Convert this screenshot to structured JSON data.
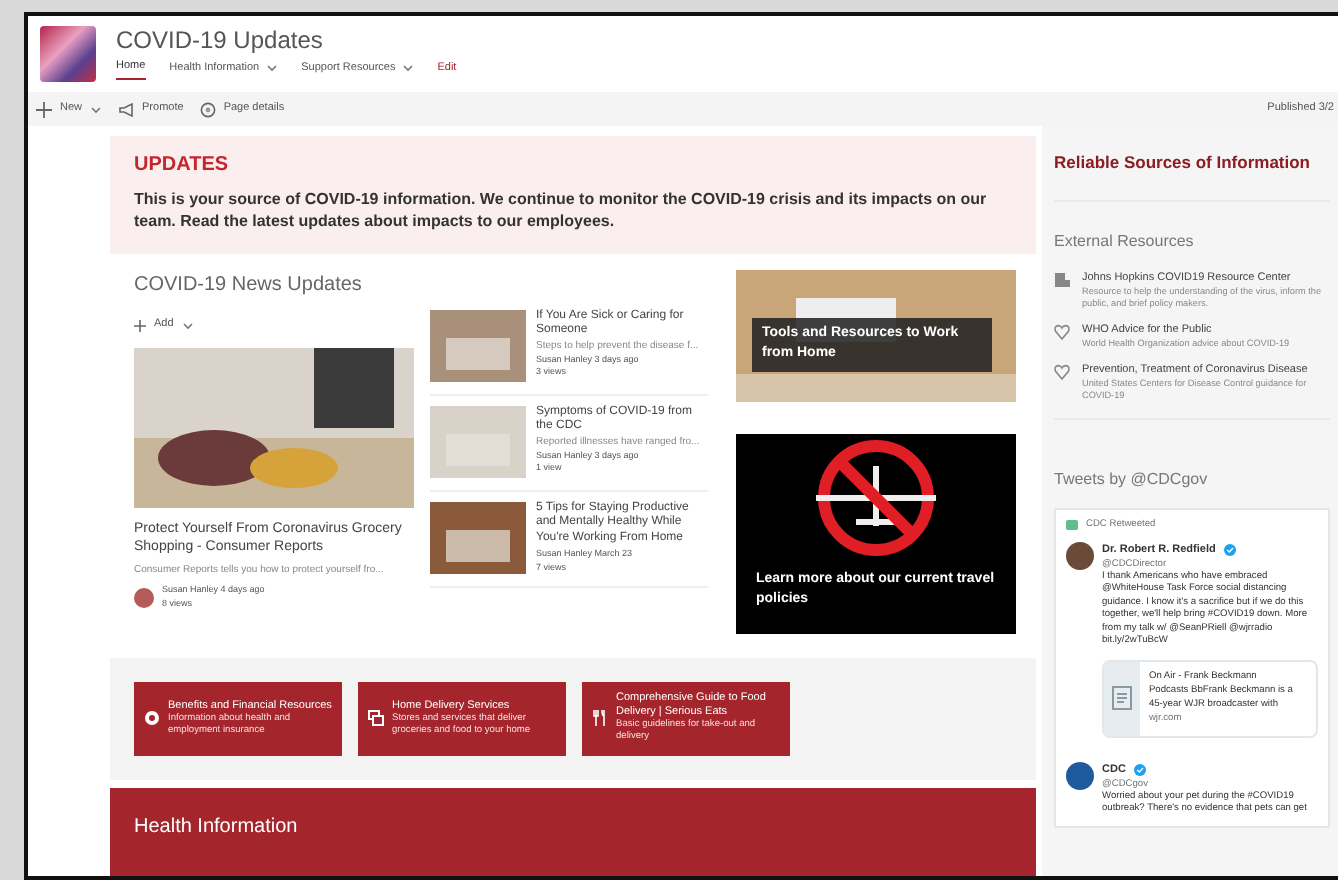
{
  "site": {
    "title": "COVID-19 Updates",
    "nav": [
      {
        "label": "Home",
        "kind": "link",
        "selected": true,
        "dropdown": false
      },
      {
        "label": "Health Information",
        "kind": "link",
        "selected": false,
        "dropdown": true
      },
      {
        "label": "Support Resources",
        "kind": "link",
        "selected": false,
        "dropdown": true
      },
      {
        "label": "Edit",
        "kind": "edit",
        "selected": false,
        "dropdown": false
      }
    ]
  },
  "command_bar": {
    "items": [
      {
        "label": "New",
        "kind": "plus",
        "dropdown": true
      },
      {
        "label": "Promote",
        "kind": "megaphone",
        "dropdown": false
      },
      {
        "label": "Page details",
        "kind": "gear",
        "dropdown": false
      }
    ],
    "published": "Published 3/2"
  },
  "updates": {
    "heading": "UPDATES",
    "text": "This is your source of COVID-19 information. We continue to monitor the COVID-19 crisis and its impacts on our team. Read the latest updates about impacts to our employees."
  },
  "news": {
    "title": "COVID-19 News Updates",
    "add": "Add",
    "featured": {
      "title": "Protect Yourself From Coronavirus Grocery Shopping - Consumer Reports",
      "summary": "Consumer Reports tells you how to protect yourself fro...",
      "author": "Susan Hanley",
      "date": "4 days ago",
      "views": "8 views"
    },
    "items": [
      {
        "title": "If You Are Sick or Caring for Someone",
        "summary": "Steps to help prevent the disease f...",
        "author": "Susan Hanley",
        "date": "3 days ago",
        "views": "3 views",
        "kind": "masks"
      },
      {
        "title": "Symptoms of COVID-19 from the CDC",
        "summary": "Reported illnesses have ranged fro...",
        "author": "Susan Hanley",
        "date": "3 days ago",
        "views": "1 view",
        "kind": "bed"
      },
      {
        "title": "5 Tips for Staying Productive and Mentally Healthy While You're Working From Home",
        "author": "Susan Hanley",
        "date": "March 23",
        "views": "7 views",
        "kind": "laptop"
      }
    ]
  },
  "tiles": [
    {
      "caption": "Tools and Resources to Work from Home",
      "kind": "photo"
    },
    {
      "caption": "Learn more about our current travel policies",
      "kind": "no-flights"
    }
  ],
  "quick_links": [
    {
      "title": "Benefits and Financial Resources",
      "description": "Information about health and employment insurance",
      "kind": "lifebuoy"
    },
    {
      "title": "Home Delivery Services",
      "description": "Stores and services that deliver groceries and food to your home",
      "kind": "windows"
    },
    {
      "title": "Comprehensive Guide to Food Delivery | Serious Eats",
      "description": "Basic guidelines for take-out and delivery",
      "kind": "utensils"
    }
  ],
  "health_band": {
    "title": "Health Information"
  },
  "sidebar": {
    "heading": "Reliable Sources of Information",
    "external": {
      "title": "External Resources",
      "items": [
        {
          "title": "Johns Hopkins COVID19 Resource Center",
          "description": "Resource to help the understanding of the virus, inform the public, and brief policy makers.",
          "kind": "building"
        },
        {
          "title": "WHO Advice for the Public",
          "description": "World Health Organization advice about COVID-19",
          "kind": "heart"
        },
        {
          "title": "Prevention, Treatment of Coronavirus Disease",
          "description": "United States Centers for Disease Control guidance for COVID-19",
          "kind": "heart"
        }
      ]
    },
    "tweets": {
      "title": "Tweets by @CDCgov",
      "items": [
        {
          "retweet_label": "CDC Retweeted",
          "name": "Dr. Robert R. Redfield",
          "verified": true,
          "handle": "@CDCDirector",
          "text": "I thank Americans who have embraced @WhiteHouse Task Force social distancing guidance. I know it's a sacrifice but if we do this together, we'll help bring #COVID19 down.  More from my talk w/ @SeanPRiell @wjrradio bit.ly/2wTuBcW",
          "card": {
            "title": "On Air - Frank Beckmann",
            "text": "Podcasts BbFrank Beckmann is a 45-year WJR broadcaster with",
            "site": "wjr.com"
          }
        },
        {
          "name": "CDC",
          "verified": true,
          "handle": "@CDCgov",
          "text": "Worried about your pet during the #COVID19 outbreak? There's no evidence that pets can get"
        }
      ]
    }
  }
}
